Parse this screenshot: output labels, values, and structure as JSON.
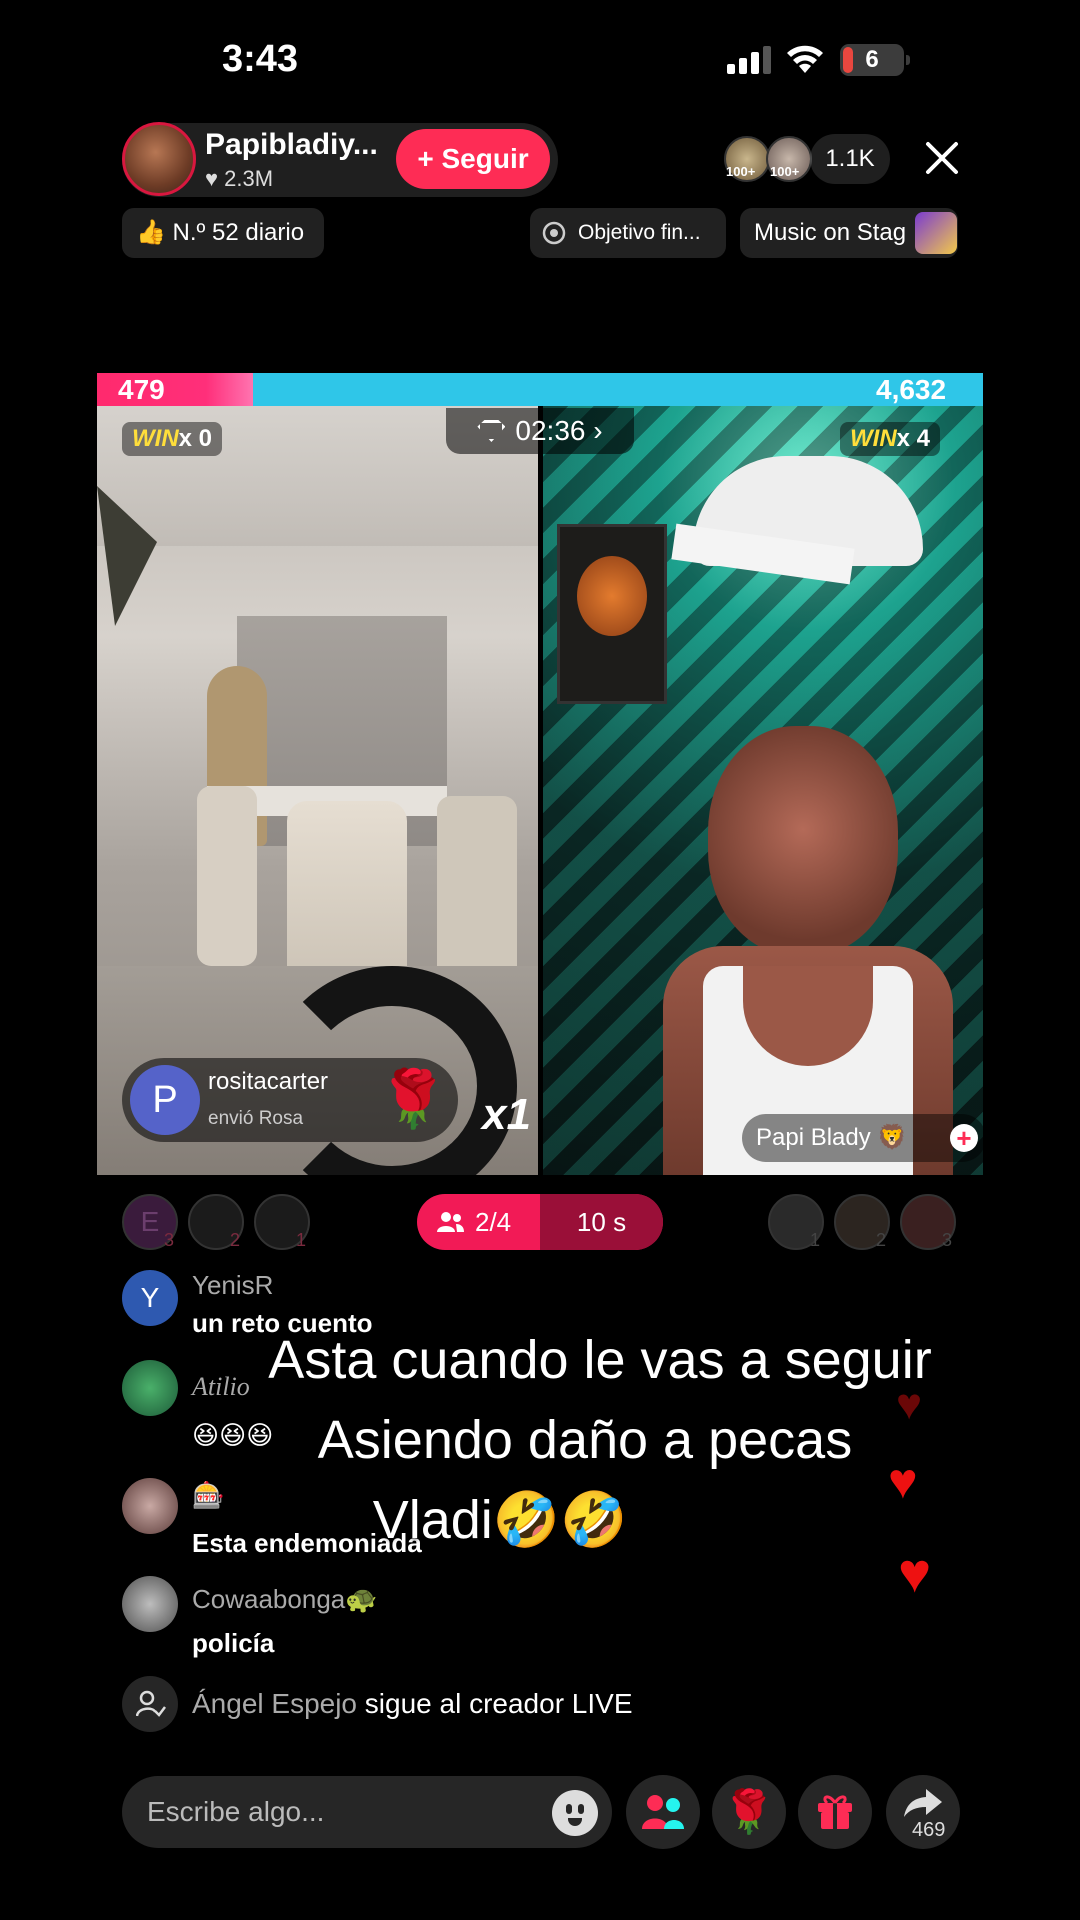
{
  "status": {
    "time": "3:43",
    "battery": "6"
  },
  "host": {
    "name": "Papibladiy...",
    "likes": "♥ 2.3M",
    "follow_label": "+ Seguir"
  },
  "viewers": {
    "badge1": "100+",
    "badge2": "100+",
    "count": "1.1K"
  },
  "badges": {
    "daily_rank": "👍 N.º 52 diario",
    "objective": "Objetivo fin...",
    "music": "Music on Stag"
  },
  "battle": {
    "score_left": "479",
    "score_right": "4,632",
    "score_left_fraction": 0.094,
    "timer": "02:36",
    "left_win": "x 0",
    "right_win": "x 4",
    "win_label": "WIN",
    "gift": {
      "user": "rositacarter",
      "action": "envió Rosa",
      "avatar_letter": "P",
      "multiplier": "x1"
    },
    "right_name": "Papi Blady 🦁"
  },
  "guests": {
    "left_ranks": [
      "3",
      "2",
      "1"
    ],
    "left_avatar_letter": "E",
    "right_ranks": [
      "1",
      "2",
      "3"
    ],
    "slots": "2/4",
    "timer": "10 s"
  },
  "comments": [
    {
      "name": "YenisR",
      "text": "un reto cuento",
      "avatar_letter": "Y"
    },
    {
      "name": "Atilio",
      "text": "😆😆😆"
    },
    {
      "name": "🎰",
      "text": "Esta endemoniada"
    },
    {
      "name": "Cowaabonga🐢",
      "text": "policía"
    }
  ],
  "follow_event": {
    "name": "Ángel Espejo",
    "text": "sigue al creador LIVE"
  },
  "caption": {
    "line1": "Asta cuando le vas a seguir",
    "line2": "Asiendo daño a pecas",
    "line3": "Vladi🤣🤣"
  },
  "bottom": {
    "input_placeholder": "Escribe algo...",
    "share_count": "469"
  },
  "colors": {
    "accent": "#fe2c55",
    "score_red": "#ff2a6d",
    "score_blue": "#2fc6e8",
    "win": "#ffde3b"
  }
}
